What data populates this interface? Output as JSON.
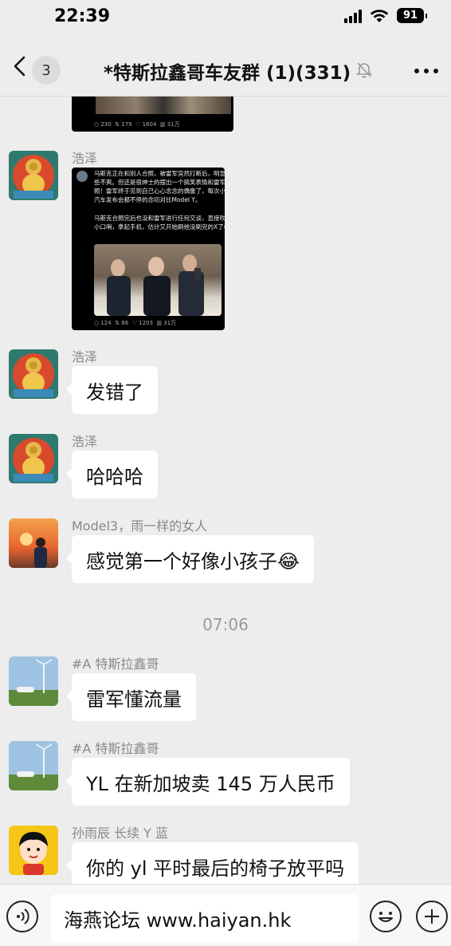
{
  "status_bar": {
    "time": "22:39",
    "battery": "91"
  },
  "header": {
    "back_count": "3",
    "title": "*特斯拉鑫哥车友群 (1)(331)"
  },
  "messages": [
    {
      "sender": "浩泽",
      "type": "image",
      "post_text_1": "马斯克正在和别人合照，被雷军突然打断后，明显有些不爽。但还是很绅士的摆出一个搞笑表情和雷军合照！雷军终于见到自己心心念念的偶像了，每次小米汽车发布会都不停的念叨对比Model Y。",
      "post_text_2": "马斯克合照完后也没和雷军进行任何交谈，直接吹着小口哨，拿起手机，估计又开始刷他没刷完的X了😊",
      "stats": [
        "124",
        "86",
        "1203",
        "31万"
      ]
    },
    {
      "sender": "浩泽",
      "text": "发错了"
    },
    {
      "sender": "浩泽",
      "text": "哈哈哈"
    },
    {
      "sender": "Model3，雨一样的女人",
      "text": "感觉第一个好像小孩子😂"
    },
    {
      "sender": "#A 特斯拉鑫哥",
      "text": "雷军懂流量"
    },
    {
      "sender": "#A 特斯拉鑫哥",
      "text": "YL 在新加坡卖 145 万人民币"
    },
    {
      "sender": "孙雨辰 长续 Y 蓝",
      "text": "你的 yl 平时最后的椅子放平吗"
    }
  ],
  "prev_image_stats": [
    "230",
    "179",
    "1604",
    "31万"
  ],
  "timestamp": "07:06",
  "input": {
    "value": "海燕论坛 www.haiyan.hk"
  },
  "icons": [
    "back-chevron-icon",
    "bell-muted-icon",
    "more-dots-icon",
    "voice-icon",
    "emoji-icon",
    "plus-icon"
  ]
}
